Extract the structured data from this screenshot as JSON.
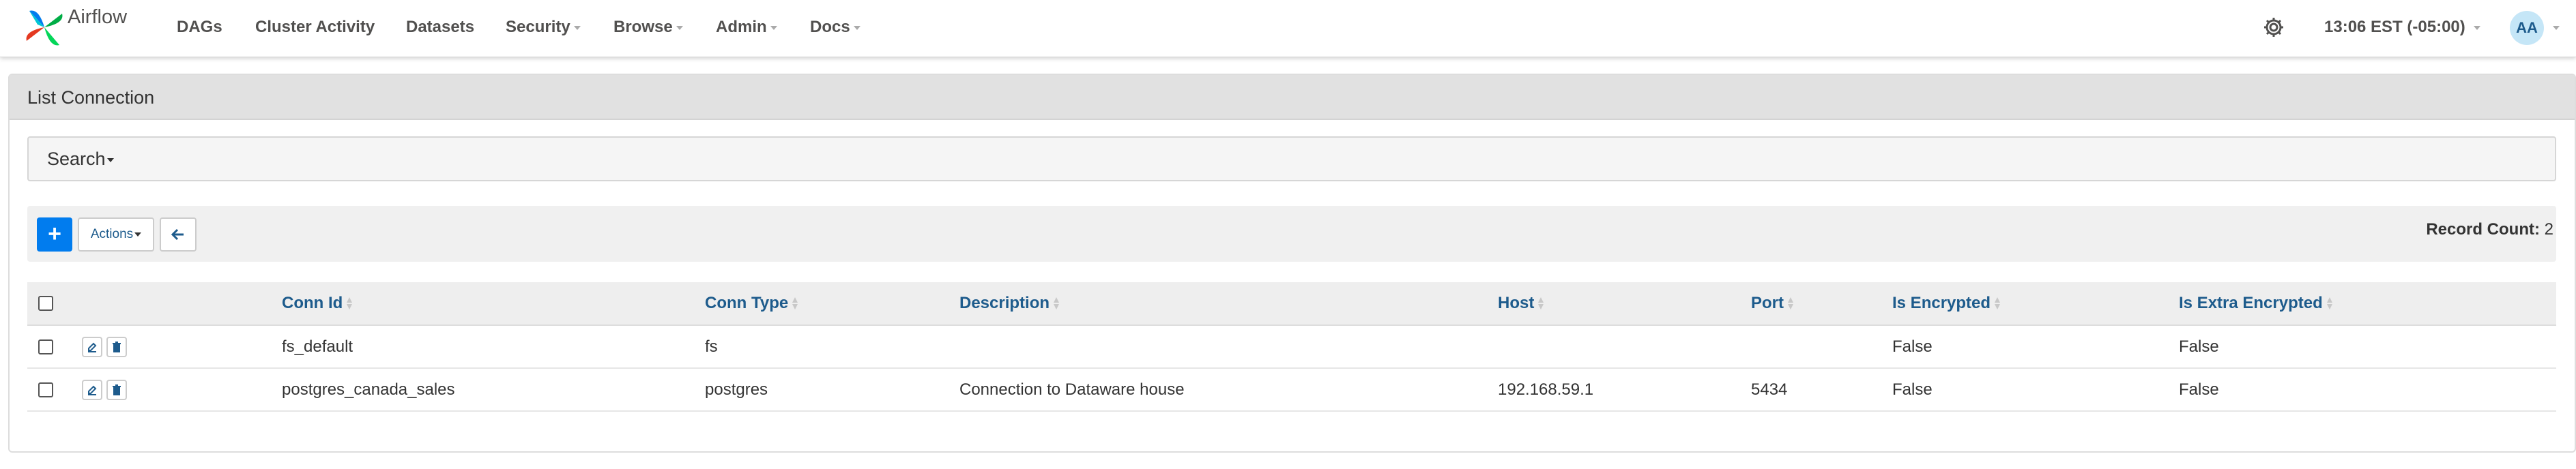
{
  "navbar": {
    "brand": "Airflow",
    "items": [
      {
        "label": "DAGs",
        "dropdown": false
      },
      {
        "label": "Cluster Activity",
        "dropdown": false
      },
      {
        "label": "Datasets",
        "dropdown": false
      },
      {
        "label": "Security",
        "dropdown": true
      },
      {
        "label": "Browse",
        "dropdown": true
      },
      {
        "label": "Admin",
        "dropdown": true
      },
      {
        "label": "Docs",
        "dropdown": true
      }
    ],
    "clock": "13:06 EST (-05:00)",
    "avatar_initials": "AA"
  },
  "page": {
    "title": "List Connection",
    "search_label": "Search",
    "add_label": "+",
    "actions_label": "Actions",
    "record_count_label": "Record Count:",
    "record_count_value": "2"
  },
  "table": {
    "headers": [
      "Conn Id",
      "Conn Type",
      "Description",
      "Host",
      "Port",
      "Is Encrypted",
      "Is Extra Encrypted"
    ],
    "rows": [
      [
        "fs_default",
        "fs",
        "",
        "",
        "",
        "False",
        "False"
      ],
      [
        "postgres_canada_sales",
        "postgres",
        "Connection to Dataware house",
        "192.168.59.1",
        "5434",
        "False",
        "False"
      ]
    ]
  },
  "colors": {
    "accent": "#017cee",
    "link": "#1d5b8c",
    "panel_heading": "#e1e1e1"
  }
}
